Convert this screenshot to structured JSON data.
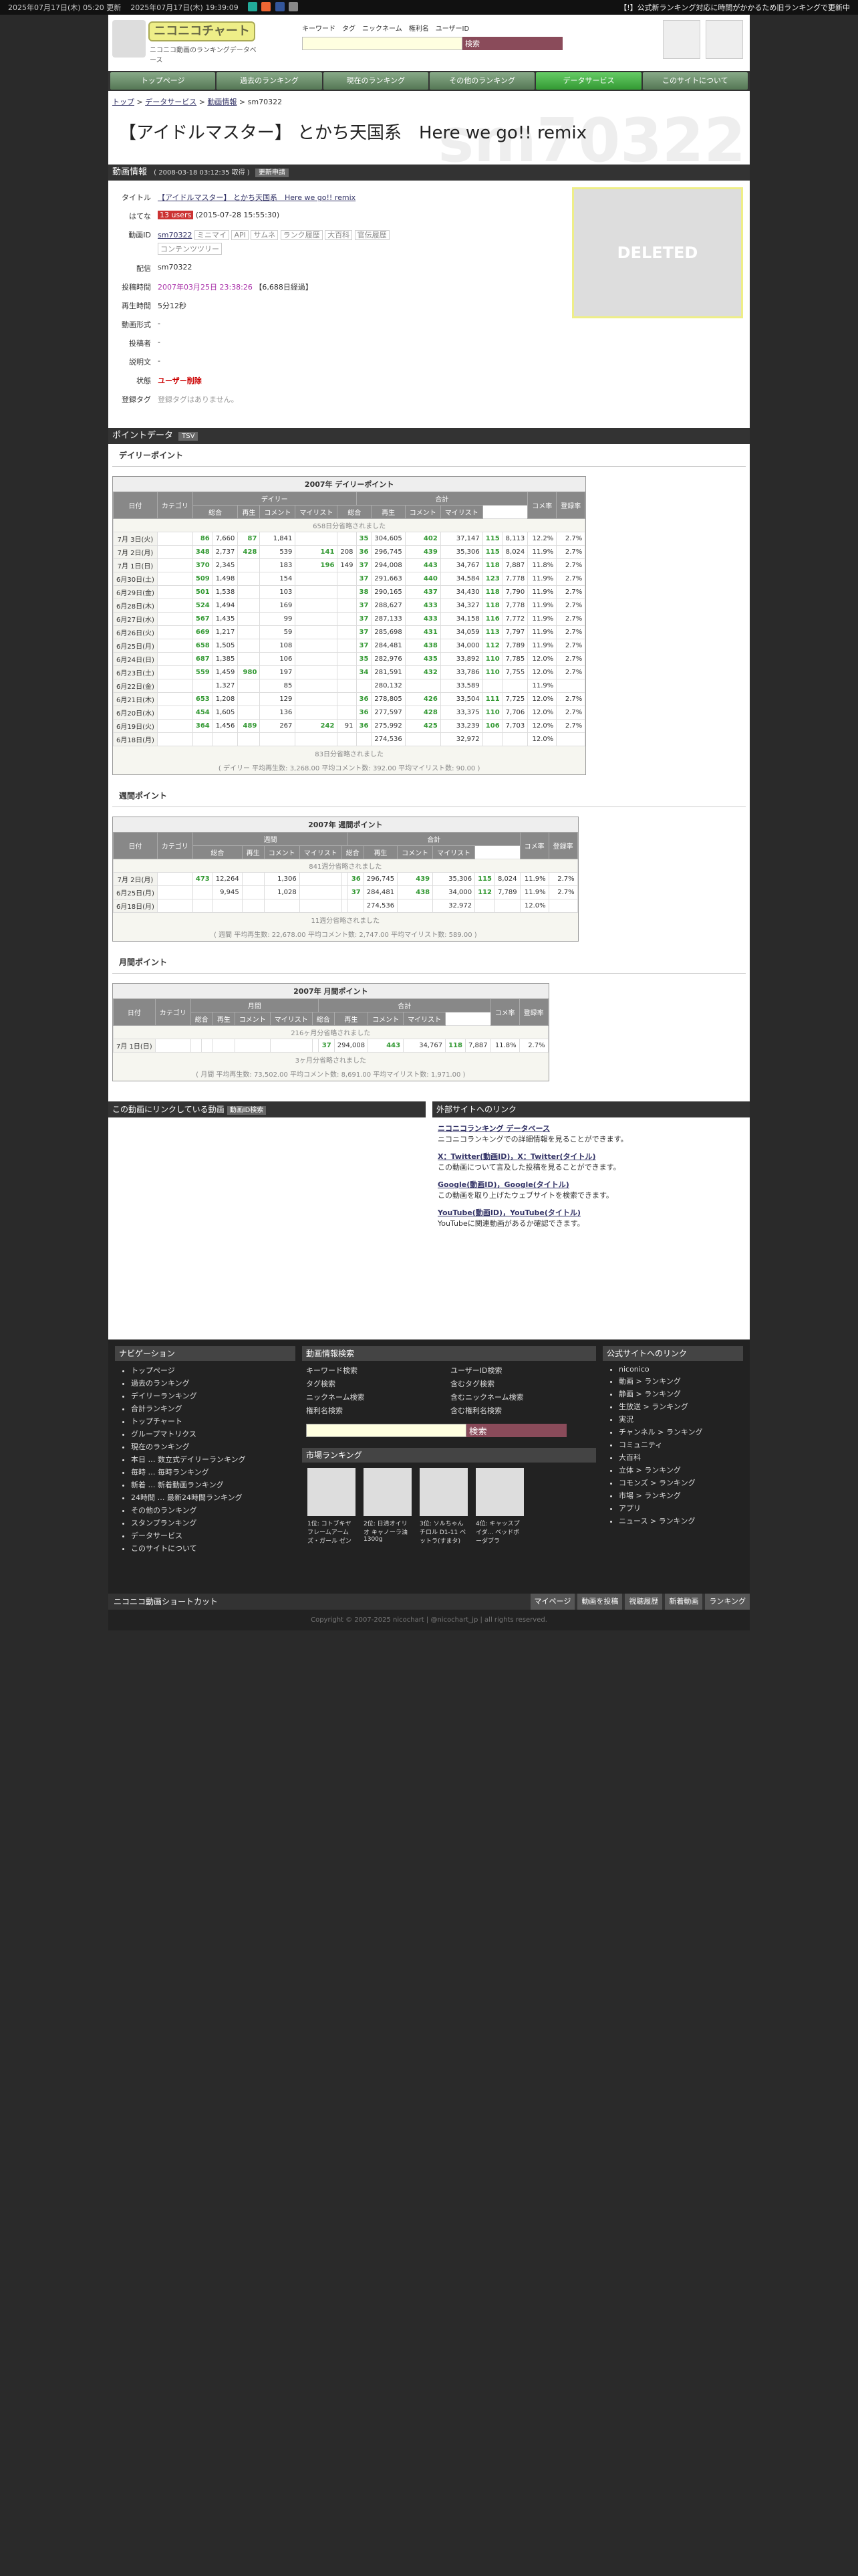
{
  "topbar": {
    "updated1": "2025年07月17日(木) 05:20 更新",
    "updated2": "2025年07月17日(木) 19:39:09",
    "notice": "【!】公式新ランキング対応に時間がかかるため旧ランキングで更新中"
  },
  "logo": {
    "title": "ニコニコチャート",
    "subtitle": "ニコニコ動画のランキングデータベース"
  },
  "search": {
    "kinds": [
      "キーワード",
      "タグ",
      "ニックネーム",
      "権利名",
      "ユーザーID"
    ],
    "button": "検索"
  },
  "gnav": [
    "トップページ",
    "過去のランキング",
    "現在のランキング",
    "その他のランキング",
    "データサービス",
    "このサイトについて"
  ],
  "breadcrumb": [
    "トップ",
    "データサービス",
    "動画情報",
    "sm70322"
  ],
  "title": "【アイドルマスター】 とかち天国系　Here we go!! remix",
  "title_bg": "sm70322",
  "info_bar": {
    "label": "動画情報",
    "sub": "( 2008-03-18 03:12:35 取得 )",
    "btn": "更新申請"
  },
  "info": {
    "title_label": "タイトル",
    "title_val": "【アイドルマスター】 とかち天国系　Here we go!! remix",
    "hatena_label": "はてな",
    "hatena_users": "13 users",
    "hatena_date": "(2015-07-28 15:55:30)",
    "id_label": "動画ID",
    "id_val": "sm70322",
    "id_tags": [
      "ミニマイ",
      "API",
      "サムネ",
      "ランク履歴",
      "大百科",
      "官伝履歴",
      "コンテンツツリー"
    ],
    "dist_label": "配信",
    "dist_val": "sm70322",
    "post_label": "投稿時間",
    "post_val": "2007年03月25日 23:38:26",
    "post_days": "【6,688日経過】",
    "len_label": "再生時間",
    "len_val": "5分12秒",
    "fmt_label": "動画形式",
    "fmt_val": "-",
    "poster_label": "投稿者",
    "poster_val": "-",
    "desc_label": "説明文",
    "desc_val": "-",
    "status_label": "状態",
    "status_val": "ユーザー削除",
    "tag_label": "登録タグ",
    "tag_val": "登録タグはありません。"
  },
  "thumb_text": "DELETED",
  "point_bar": {
    "label": "ポイントデータ",
    "btn": "TSV"
  },
  "daily": {
    "heading": "デイリーポイント",
    "caption": "2007年 デイリーポイント",
    "omit_top": "658日分省略されました",
    "omit_bottom": "83日分省略されました",
    "footer": "( デイリー 平均再生数: 3,268.00 平均コメント数: 392.00 平均マイリスト数: 90.00 )",
    "rows": [
      [
        "7月 3日(火)",
        "86",
        "7,660",
        "87",
        "1,841",
        "",
        "",
        "35",
        "304,605",
        "402",
        "37,147",
        "115",
        "8,113",
        "12.2%",
        "2.7%"
      ],
      [
        "7月 2日(月)",
        "348",
        "2,737",
        "428",
        "539",
        "141",
        "208",
        "36",
        "296,745",
        "439",
        "35,306",
        "115",
        "8,024",
        "11.9%",
        "2.7%"
      ],
      [
        "7月 1日(日)",
        "370",
        "2,345",
        "",
        "183",
        "196",
        "149",
        "37",
        "294,008",
        "443",
        "34,767",
        "118",
        "7,887",
        "11.8%",
        "2.7%"
      ],
      [
        "6月30日(土)",
        "509",
        "1,498",
        "",
        "154",
        "",
        "",
        "37",
        "291,663",
        "440",
        "34,584",
        "123",
        "7,778",
        "11.9%",
        "2.7%"
      ],
      [
        "6月29日(金)",
        "501",
        "1,538",
        "",
        "103",
        "",
        "",
        "38",
        "290,165",
        "437",
        "34,430",
        "118",
        "7,790",
        "11.9%",
        "2.7%"
      ],
      [
        "6月28日(木)",
        "524",
        "1,494",
        "",
        "169",
        "",
        "",
        "37",
        "288,627",
        "433",
        "34,327",
        "118",
        "7,778",
        "11.9%",
        "2.7%"
      ],
      [
        "6月27日(水)",
        "567",
        "1,435",
        "",
        "99",
        "",
        "",
        "37",
        "287,133",
        "433",
        "34,158",
        "116",
        "7,772",
        "11.9%",
        "2.7%"
      ],
      [
        "6月26日(火)",
        "669",
        "1,217",
        "",
        "59",
        "",
        "",
        "37",
        "285,698",
        "431",
        "34,059",
        "113",
        "7,797",
        "11.9%",
        "2.7%"
      ],
      [
        "6月25日(月)",
        "658",
        "1,505",
        "",
        "108",
        "",
        "",
        "37",
        "284,481",
        "438",
        "34,000",
        "112",
        "7,789",
        "11.9%",
        "2.7%"
      ],
      [
        "6月24日(日)",
        "687",
        "1,385",
        "",
        "106",
        "",
        "",
        "35",
        "282,976",
        "435",
        "33,892",
        "110",
        "7,785",
        "12.0%",
        "2.7%"
      ],
      [
        "6月23日(土)",
        "559",
        "1,459",
        "980",
        "197",
        "",
        "",
        "34",
        "281,591",
        "432",
        "33,786",
        "110",
        "7,755",
        "12.0%",
        "2.7%"
      ],
      [
        "6月22日(金)",
        "",
        "1,327",
        "",
        "85",
        "",
        "",
        "",
        "280,132",
        "",
        "33,589",
        "",
        "",
        "11.9%",
        ""
      ],
      [
        "6月21日(木)",
        "653",
        "1,208",
        "",
        "129",
        "",
        "",
        "36",
        "278,805",
        "426",
        "33,504",
        "111",
        "7,725",
        "12.0%",
        "2.7%"
      ],
      [
        "6月20日(水)",
        "454",
        "1,605",
        "",
        "136",
        "",
        "",
        "36",
        "277,597",
        "428",
        "33,375",
        "110",
        "7,706",
        "12.0%",
        "2.7%"
      ],
      [
        "6月19日(火)",
        "364",
        "1,456",
        "489",
        "267",
        "242",
        "91",
        "36",
        "275,992",
        "425",
        "33,239",
        "106",
        "7,703",
        "12.0%",
        "2.7%"
      ],
      [
        "6月18日(月)",
        "",
        "",
        "",
        "",
        "",
        "",
        "",
        "274,536",
        "",
        "32,972",
        "",
        "",
        "12.0%",
        ""
      ]
    ]
  },
  "weekly": {
    "heading": "週間ポイント",
    "caption": "2007年 週間ポイント",
    "omit_top": "841週分省略されました",
    "omit_bottom": "11週分省略されました",
    "footer": "( 週間 平均再生数: 22,678.00 平均コメント数: 2,747.00 平均マイリスト数: 589.00 )",
    "rows": [
      [
        "7月 2日(月)",
        "473",
        "12,264",
        "",
        "1,306",
        "",
        "",
        "36",
        "296,745",
        "439",
        "35,306",
        "115",
        "8,024",
        "11.9%",
        "2.7%"
      ],
      [
        "6月25日(月)",
        "",
        "9,945",
        "",
        "1,028",
        "",
        "",
        "37",
        "284,481",
        "438",
        "34,000",
        "112",
        "7,789",
        "11.9%",
        "2.7%"
      ],
      [
        "6月18日(月)",
        "",
        "",
        "",
        "",
        "",
        "",
        "",
        "274,536",
        "",
        "32,972",
        "",
        "",
        "12.0%",
        ""
      ]
    ]
  },
  "monthly": {
    "heading": "月間ポイント",
    "caption": "2007年 月間ポイント",
    "omit_top": "216ヶ月分省略されました",
    "omit_bottom": "3ヶ月分省略されました",
    "footer": "( 月間 平均再生数: 73,502.00 平均コメント数: 8,691.00 平均マイリスト数: 1,971.00 )",
    "rows": [
      [
        "7月 1日(日)",
        "",
        "",
        "",
        "",
        "",
        "",
        "37",
        "294,008",
        "443",
        "34,767",
        "118",
        "7,887",
        "11.8%",
        "2.7%"
      ]
    ]
  },
  "table_headers": {
    "date": "日付",
    "date_daily_sub": "(午前5時集計)",
    "date_weekly_sub": "(毎週月曜日集計)",
    "date_monthly_sub": "(毎月1日集計)",
    "cat": "カテゴリ",
    "daily": "デイリー",
    "weekly": "週間",
    "monthly": "月間",
    "total": "合計",
    "sogo": "総合",
    "play": "再生",
    "comment": "コメント",
    "mylist": "マイリスト",
    "comrate": "コメ率",
    "regrate": "登録率"
  },
  "link_col": {
    "title": "この動画にリンクしている動画",
    "btn": "動画ID検索"
  },
  "ext_col": {
    "title": "外部サイトへのリンク",
    "items": [
      [
        "ニコニコランキング データベース",
        "ニコニコランキングでの詳細情報を見ることができます。"
      ],
      [
        "X：Twitter(動画ID)，X：Twitter(タイトル)",
        "この動画について言及した投稿を見ることができます。"
      ],
      [
        "Google(動画ID)，Google(タイトル)",
        "この動画を取り上げたウェブサイトを検索できます。"
      ],
      [
        "YouTube(動画ID)，YouTube(タイトル)",
        "YouTubeに関連動画があるか確認できます。"
      ]
    ]
  },
  "nav": {
    "title": "ナビゲーション",
    "items": [
      "トップページ",
      "過去のランキング",
      "デイリーランキング",
      "合計ランキング",
      "トップチャート",
      "グループマトリクス",
      "現在のランキング",
      "本日 … 数立式デイリーランキング",
      "毎時 … 毎時ランキング",
      "新着 … 新着動画ランキング",
      "24時間 … 最新24時間ランキング",
      "その他のランキング",
      "スタンプランキング",
      "データサービス",
      "このサイトについて"
    ]
  },
  "search_box": {
    "title": "動画情報検索",
    "items": [
      "キーワード検索",
      "ユーザーID検索",
      "タグ検索",
      "含むタグ検索",
      "ニックネーム検索",
      "含むニックネーム検索",
      "権利名検索",
      "含む権利名検索"
    ],
    "button": "検索"
  },
  "market": {
    "title": "市場ランキング",
    "items": [
      "1位: コトブキヤ フレームアームズ・ガール ゼン",
      "2位: 日清オイリオ キャノーラ油 1300g",
      "3位: ソルちゃん チロル D1-11 ベットラ(すまタ)",
      "4位: キャッスプ イダ... ベッドポーダブラ"
    ]
  },
  "official": {
    "title": "公式サイトへのリンク",
    "items": [
      "niconico",
      "動画 > ランキング",
      "静画 > ランキング",
      "生放送 > ランキング",
      "実況",
      "チャンネル > ランキング",
      "コミュニティ",
      "大百科",
      "立体 > ランキング",
      "コモンズ > ランキング",
      "市場 > ランキング",
      "アプリ",
      "ニュース > ランキング"
    ]
  },
  "shortcut": {
    "title": "ニコニコ動画ショートカット",
    "links": [
      "マイページ",
      "動画を投稿",
      "視聴履歴",
      "新着動画",
      "ランキング"
    ]
  },
  "copyright": "Copyright © 2007-2025 nicochart | @nicochart_jp | all rights reserved."
}
